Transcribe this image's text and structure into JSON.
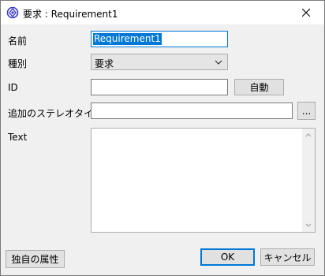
{
  "window": {
    "title": "要求 : Requirement1",
    "close_icon": "close-icon",
    "app_icon": "requirement-icon"
  },
  "form": {
    "name_label": "名前",
    "name_value": "Requirement1",
    "type_label": "種別",
    "type_value": "要求",
    "id_label": "ID",
    "id_value": "",
    "auto_button": "自動",
    "stereotype_label": "追加のステレオタイプ",
    "stereotype_value": "",
    "browse_button": "...",
    "text_label": "Text",
    "text_value": ""
  },
  "footer": {
    "properties_button": "独自の属性",
    "ok_button": "OK",
    "cancel_button": "キャンセル"
  },
  "colors": {
    "accent": "#0078d7",
    "icon_ring": "#3a3ac8"
  }
}
